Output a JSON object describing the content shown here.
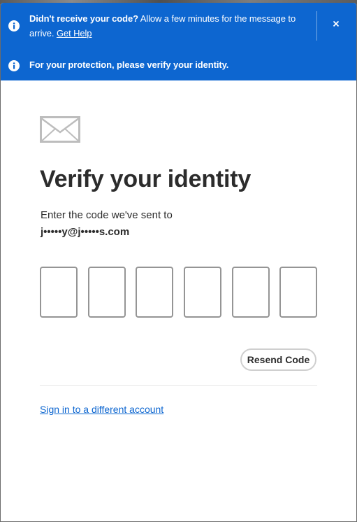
{
  "banners": {
    "code_notice": {
      "bold_text": "Didn't receive your code?",
      "text": " Allow a few minutes for the message to arrive.",
      "link_label": "Get Help",
      "close_label": "×"
    },
    "protection_notice": {
      "text": "For your protection, please verify your identity."
    }
  },
  "main": {
    "title": "Verify your identity",
    "instruction": "Enter the code we've sent to",
    "email": "j•••••y@j•••••s.com",
    "code_digit_count": 6,
    "resend_label": "Resend Code",
    "switch_account_label": "Sign in to a different account"
  },
  "colors": {
    "banner_background": "#0d66d0",
    "link": "#0d66d0",
    "heading_text": "#2c2c2c",
    "input_border": "#959595"
  },
  "icons": {
    "banner_icon": "info-icon",
    "close_icon": "close-icon",
    "mail_icon": "envelope-icon"
  }
}
